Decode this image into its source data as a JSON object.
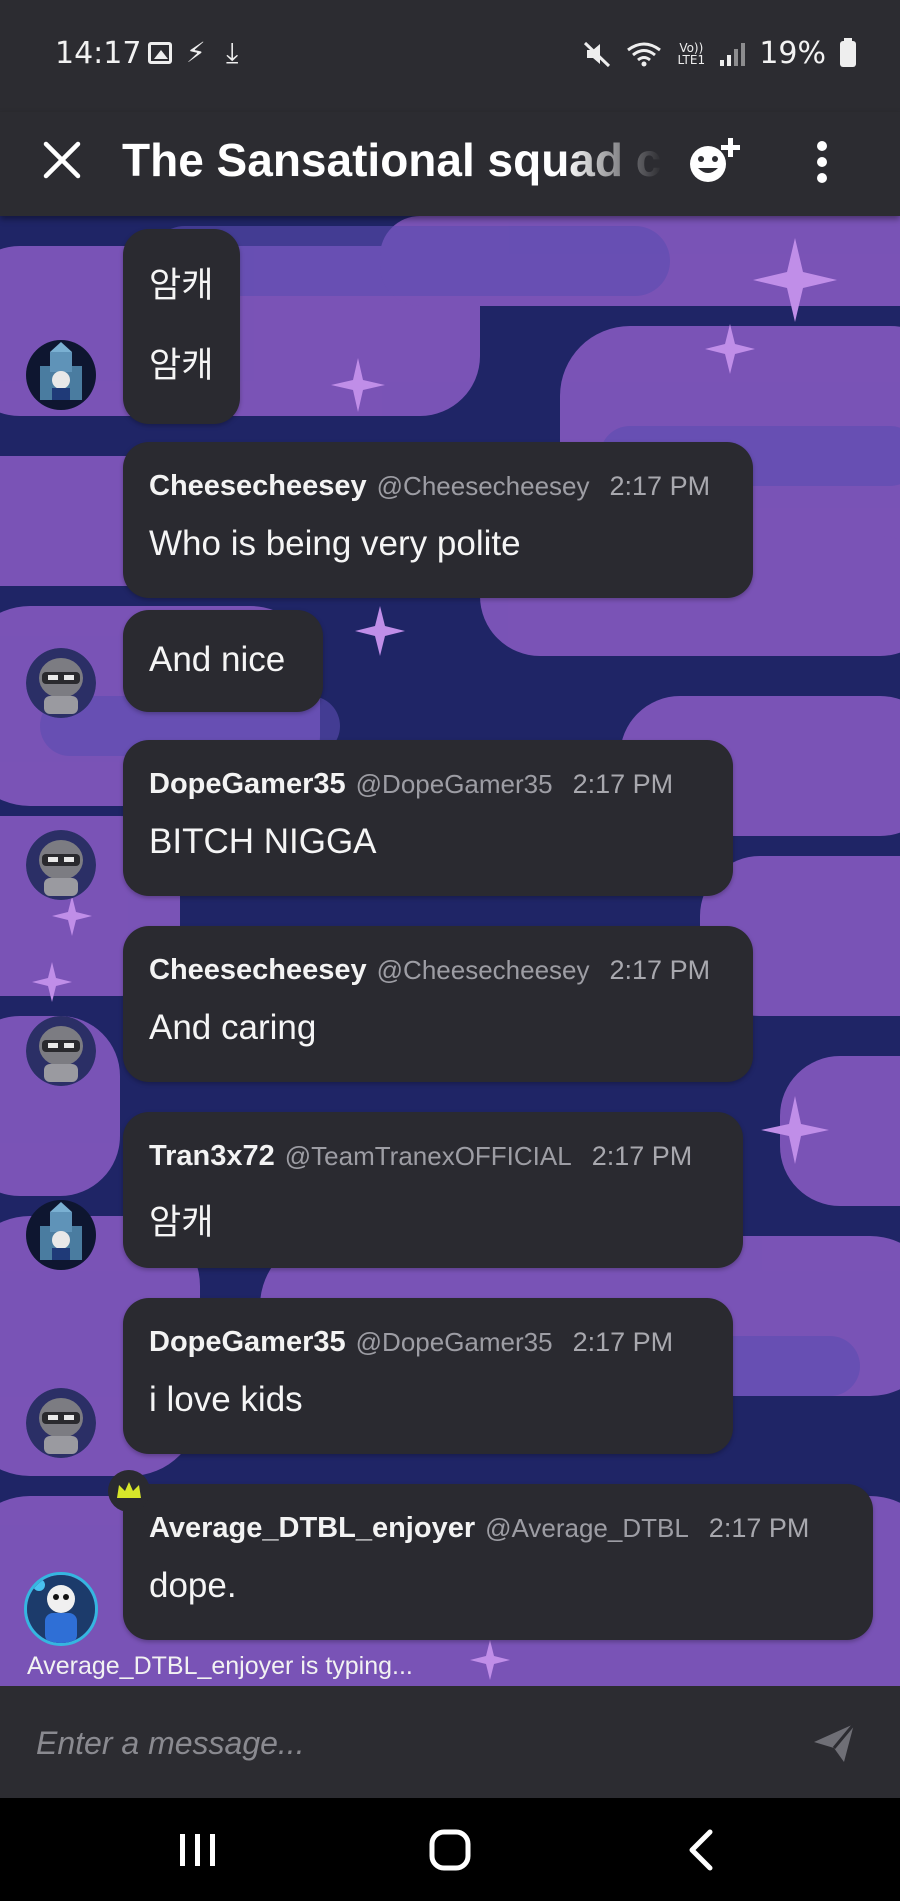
{
  "status_bar": {
    "time": "14:17",
    "battery": "19%",
    "lte_label": "Vo)) LTE1"
  },
  "header": {
    "title": "The Sansational squad chat"
  },
  "messages": [
    {
      "lines": [
        "암캐",
        "암캐"
      ]
    },
    {
      "name": "Cheesecheesey",
      "handle": "@Cheesecheesey",
      "time": "2:17 PM",
      "text": "Who is being very polite"
    },
    {
      "text": "And nice"
    },
    {
      "name": "DopeGamer35",
      "handle": "@DopeGamer35",
      "time": "2:17 PM",
      "text": "BITCH NIGGA"
    },
    {
      "name": "Cheesecheesey",
      "handle": "@Cheesecheesey",
      "time": "2:17 PM",
      "text": "And caring"
    },
    {
      "name": "Tran3x72",
      "handle": "@TeamTranexOFFICIAL",
      "time": "2:17 PM",
      "text": "암캐"
    },
    {
      "name": "DopeGamer35",
      "handle": "@DopeGamer35",
      "time": "2:17 PM",
      "text": "i love kids"
    },
    {
      "name": "Average_DTBL_enjoyer",
      "handle": "@Average_DTBL",
      "time": "2:17 PM",
      "text": "dope."
    }
  ],
  "typing_indicator": "Average_DTBL_enjoyer is typing...",
  "composer": {
    "placeholder": "Enter a message..."
  },
  "colors": {
    "bubble": "#2a2a30",
    "bar": "#2c2c31",
    "background_blue": "#1f2566",
    "background_purple": "#8a5cc4",
    "crown": "#d7e62a"
  },
  "icons": {
    "close": "close-icon",
    "add_member": "add-member-icon",
    "more": "more-vertical-icon",
    "send": "send-icon",
    "crown": "crown-icon"
  }
}
